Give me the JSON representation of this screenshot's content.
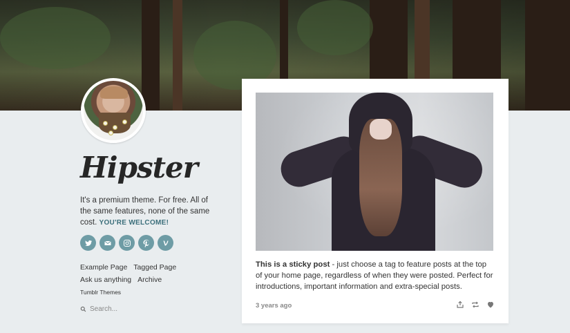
{
  "blog": {
    "title": "Hipster",
    "description": "It's a premium theme. For free. All of the same features, none of the same cost.",
    "cta": "YOU'RE WELCOME!"
  },
  "socials": [
    {
      "name": "twitter-icon",
      "glyph": "t"
    },
    {
      "name": "email-icon",
      "glyph": "✉"
    },
    {
      "name": "instagram-icon",
      "glyph": "◎"
    },
    {
      "name": "pinterest-icon",
      "glyph": "p"
    },
    {
      "name": "vine-icon",
      "glyph": "v"
    }
  ],
  "pages": {
    "example": "Example Page",
    "tagged": "Tagged Page",
    "ask": "Ask us anything",
    "archive": "Archive"
  },
  "theme_link": "Tumblr Themes",
  "search": {
    "placeholder": "Search..."
  },
  "post": {
    "bold_lead": "This is a sticky post",
    "body": " - just choose a tag to feature posts at the top of your home page, regardless of when they were posted. Perfect for introductions, important information and extra-special posts.",
    "timestamp": "3 years ago"
  },
  "colors": {
    "background": "#e9edef",
    "accent": "#6e9ca5",
    "cta": "#3c6f7b"
  }
}
